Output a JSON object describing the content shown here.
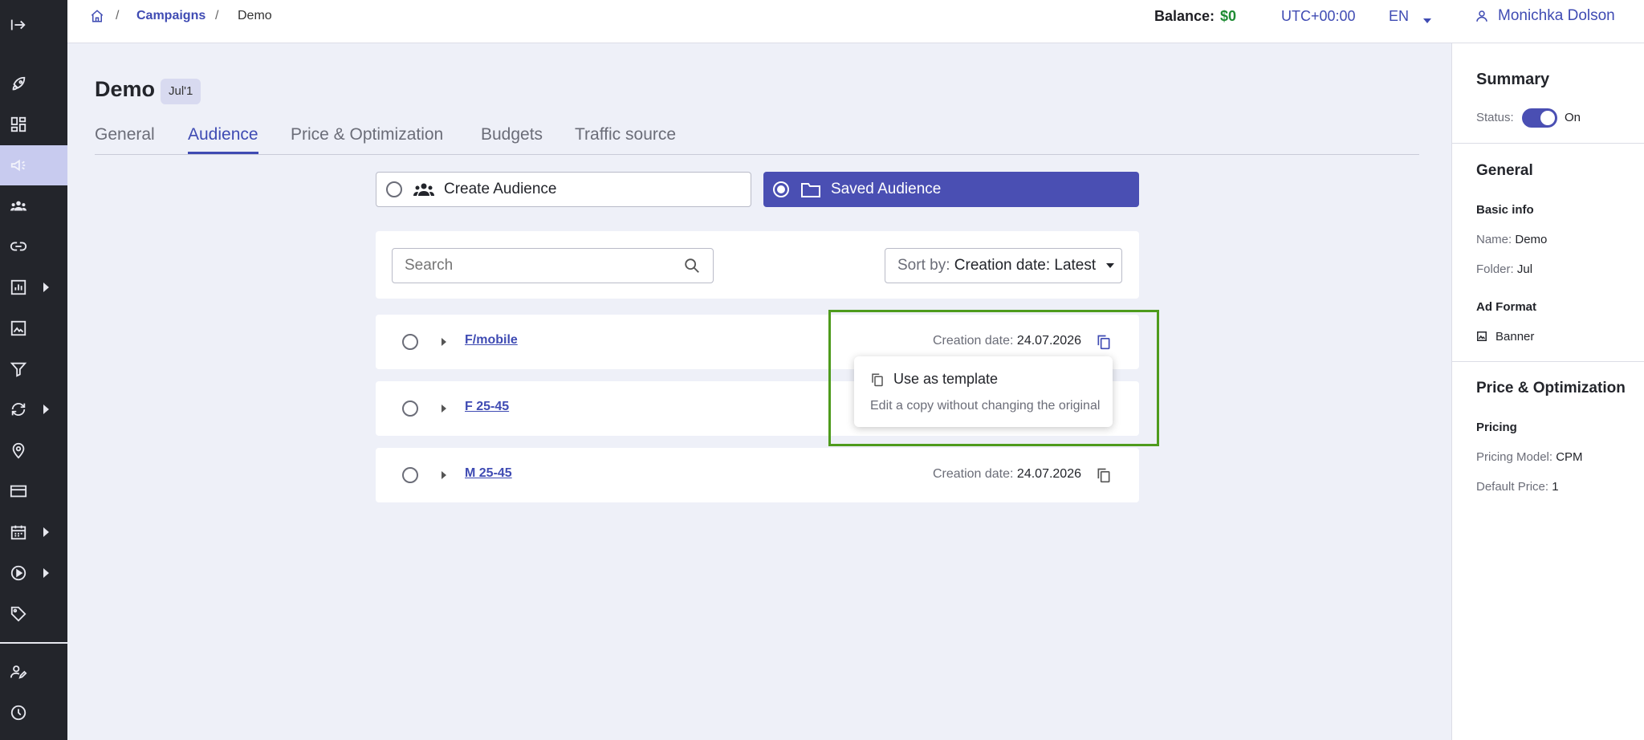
{
  "sidebar": {
    "icons": [
      "collapse-icon",
      "rocket-icon",
      "dashboard-icon",
      "megaphone-icon",
      "audience-icon",
      "link-icon",
      "chart-icon",
      "image-icon",
      "filter-icon",
      "sync-icon",
      "location-icon",
      "card-icon",
      "calendar-icon",
      "play-icon",
      "tag-icon",
      "user-edit-icon",
      "clock-icon"
    ]
  },
  "header": {
    "breadcrumb": {
      "campaigns": "Campaigns",
      "current": "Demo",
      "sep": "/"
    },
    "balance_label": "Balance:",
    "balance_value": "$0",
    "timezone": "UTC+00:00",
    "language": "EN",
    "user_name": "Monichka Dolson"
  },
  "page": {
    "title": "Demo",
    "badge": "Jul'1",
    "tabs": [
      {
        "label": "General"
      },
      {
        "label": "Audience"
      },
      {
        "label": "Price & Optimization"
      },
      {
        "label": "Budgets"
      },
      {
        "label": "Traffic source"
      }
    ],
    "audience_modes": {
      "create": "Create Audience",
      "saved": "Saved Audience"
    },
    "search_placeholder": "Search",
    "sort": {
      "label": "Sort by:",
      "value": "Creation date: Latest"
    },
    "rows": [
      {
        "name": "F/mobile",
        "date_label": "Creation date:",
        "date": "24.07.2026"
      },
      {
        "name": "F 25-45",
        "date_label": "",
        "date": ""
      },
      {
        "name": "M 25-45",
        "date_label": "Creation date:",
        "date": "24.07.2026"
      }
    ],
    "popover": {
      "title": "Use as template",
      "description": "Edit a copy without changing the original"
    }
  },
  "summary": {
    "title": "Summary",
    "status_label": "Status:",
    "status_value": "On",
    "general_title": "General",
    "basic_info": "Basic info",
    "name_label": "Name:",
    "name_value": "Demo",
    "folder_label": "Folder:",
    "folder_value": "Jul",
    "ad_format_title": "Ad Format",
    "ad_format_value": "Banner",
    "price_title": "Price & Optimization",
    "pricing": "Pricing",
    "pricing_model_label": "Pricing Model:",
    "pricing_model_value": "CPM",
    "default_price_label": "Default Price:",
    "default_price_value": "1"
  },
  "colors": {
    "accent": "#3f4bb3",
    "primary_button": "#4a4fb3",
    "balance": "#1e8b33",
    "highlight": "#4e9b1d",
    "sidebar": "#23252b"
  }
}
